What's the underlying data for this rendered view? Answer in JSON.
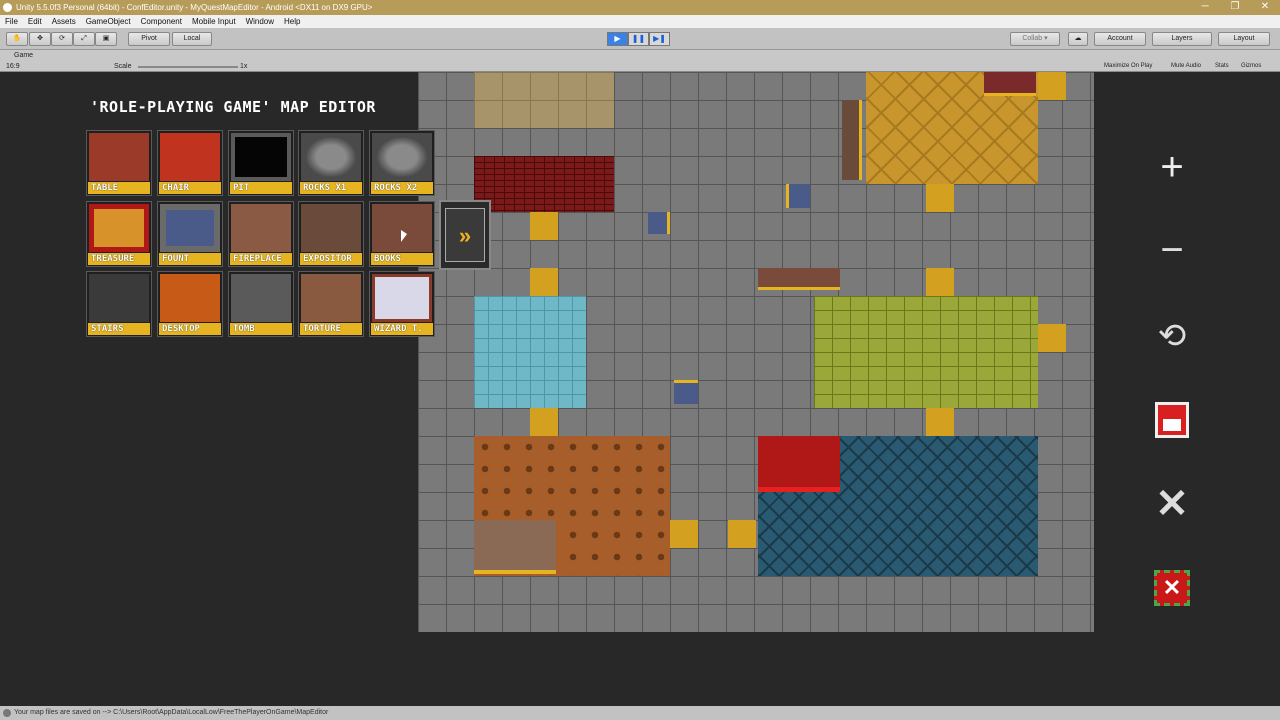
{
  "window": {
    "title": "Unity 5.5.0f3 Personal (64bit) - ConfEditor.unity - MyQuestMapEditor - Android <DX11 on DX9 GPU>",
    "controls": [
      "─",
      "❐",
      "✕"
    ]
  },
  "menu": [
    "File",
    "Edit",
    "Assets",
    "GameObject",
    "Component",
    "Mobile Input",
    "Window",
    "Help"
  ],
  "toolbar": {
    "pivot": "Pivot",
    "local": "Local",
    "collab": "Collab ▾",
    "account": "Account",
    "layers": "Layers",
    "layout": "Layout"
  },
  "game_view": {
    "tab": "Game",
    "aspect": "16:9",
    "scale_label": "Scale",
    "scale_value": "1x",
    "options": [
      "Maximize On Play",
      "Mute Audio",
      "Stats",
      "Gizmos"
    ]
  },
  "editor": {
    "title": "'ROLE-PLAYING GAME' MAP EDITOR",
    "palette": [
      {
        "label": "TABLE",
        "color": "#9c3a2a"
      },
      {
        "label": "CHAIR",
        "color": "#c0331f"
      },
      {
        "label": "PIT",
        "color": "#050505"
      },
      {
        "label": "ROCKS X1",
        "color": "#6a6a6a"
      },
      {
        "label": "ROCKS X2",
        "color": "#6a6a6a"
      },
      {
        "label": "TREASURE",
        "color": "#d8922a"
      },
      {
        "label": "FOUNT",
        "color": "#4a5b8a"
      },
      {
        "label": "FIREPLACE",
        "color": "#8a5a45"
      },
      {
        "label": "EXPOSITOR",
        "color": "#6a4a3a"
      },
      {
        "label": "BOOKS",
        "color": "#7a4a3a"
      },
      {
        "label": "STAIRS",
        "color": "#3a3a3a"
      },
      {
        "label": "DESKTOP",
        "color": "#c85a18"
      },
      {
        "label": "TOMB",
        "color": "#5a5a5a"
      },
      {
        "label": "TORTURE",
        "color": "#8a5a40"
      },
      {
        "label": "WIZARD T.",
        "color": "#d8d8e8"
      }
    ],
    "next_icon": "double-chevron-right-icon",
    "side_buttons": [
      "zoom-in-icon",
      "zoom-out-icon",
      "rotate-icon",
      "save-icon",
      "clear-icon",
      "delete-icon"
    ]
  },
  "status": "Your map files are saved on --> C:\\Users\\Root\\AppData\\LocalLow\\FreeThePlayerOnGame\\MapEditor"
}
